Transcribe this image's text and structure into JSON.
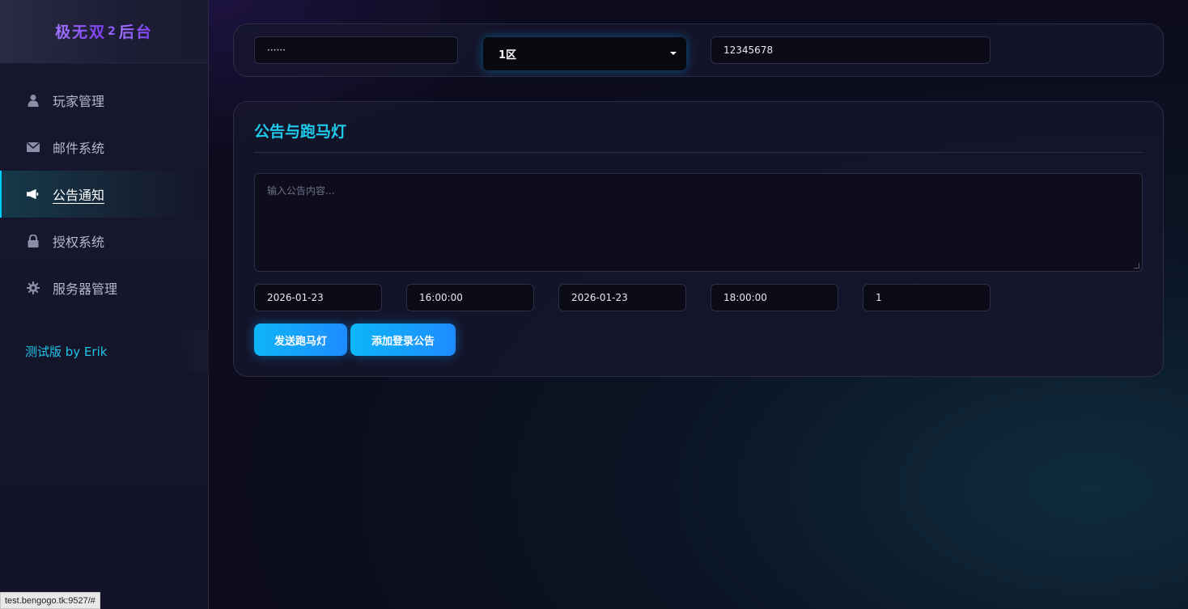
{
  "sidebar": {
    "brand": {
      "part1": "极无双",
      "num": "2",
      "part2": "后台"
    },
    "items": [
      {
        "label": "玩家管理",
        "icon": "user-icon"
      },
      {
        "label": "邮件系统",
        "icon": "envelope-icon"
      },
      {
        "label": "公告通知",
        "icon": "megaphone-icon",
        "active": true
      },
      {
        "label": "授权系统",
        "icon": "lock-icon"
      },
      {
        "label": "服务器管理",
        "icon": "gear-icon"
      }
    ],
    "footer": "测试版 by Erik"
  },
  "top_bar": {
    "password_value": "······",
    "server_select": "1区",
    "account_id": "12345678"
  },
  "announcement": {
    "title": "公告与跑马灯",
    "content_placeholder": "输入公告内容...",
    "start_date": "2026-01-23",
    "start_time": "16:00:00",
    "end_date": "2026-01-23",
    "end_time": "18:00:00",
    "repeat": "1",
    "send_marquee_label": "发送跑马灯",
    "add_login_notice_label": "添加登录公告"
  },
  "status_bar": {
    "url": "test.bengogo.tk:9527/#"
  },
  "colors": {
    "accent": "#1ecbea",
    "brand": "#8a5cf6",
    "button": "#1e8cff"
  }
}
